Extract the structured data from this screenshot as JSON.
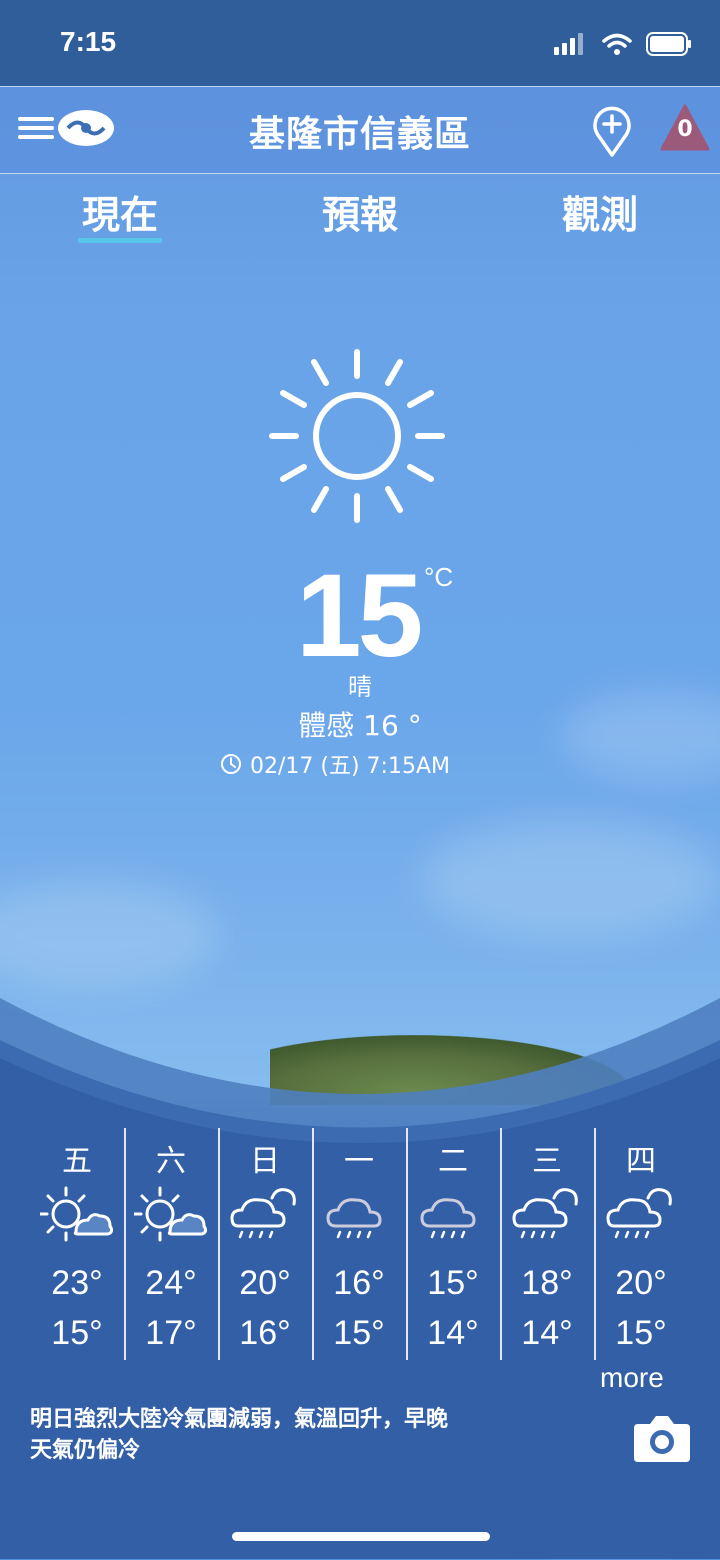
{
  "status_bar": {
    "time": "7:15"
  },
  "header": {
    "title": "基隆市信義區",
    "alert_count": "0"
  },
  "tabs": [
    {
      "label": "現在",
      "active": true
    },
    {
      "label": "預報",
      "active": false
    },
    {
      "label": "觀測",
      "active": false
    }
  ],
  "current": {
    "icon": "sun-icon",
    "temperature": "15",
    "unit": "°C",
    "condition": "晴",
    "feels_like": "體感 16 °",
    "timestamp": "02/17 (五) 7:15AM"
  },
  "forecast": [
    {
      "day": "五",
      "icon": "sunny-cloudy-icon",
      "high": "23°",
      "low": "15°"
    },
    {
      "day": "六",
      "icon": "sunny-cloudy-icon",
      "high": "24°",
      "low": "17°"
    },
    {
      "day": "日",
      "icon": "cloud-rain-icon",
      "high": "20°",
      "low": "16°"
    },
    {
      "day": "一",
      "icon": "rain-icon",
      "high": "16°",
      "low": "15°"
    },
    {
      "day": "二",
      "icon": "rain-icon",
      "high": "15°",
      "low": "14°"
    },
    {
      "day": "三",
      "icon": "cloud-rain-icon",
      "high": "18°",
      "low": "14°"
    },
    {
      "day": "四",
      "icon": "cloud-rain-icon",
      "high": "20°",
      "low": "15°"
    }
  ],
  "more_label": "more",
  "summary": {
    "line1": "明日強烈大陸冷氣團減弱，氣溫回升，早晚",
    "line2": "天氣仍偏冷"
  },
  "colors": {
    "tab_underline": "#58c6e8",
    "alert_badge": "#9b5a7a",
    "status_bar": "#2f5e9b"
  }
}
